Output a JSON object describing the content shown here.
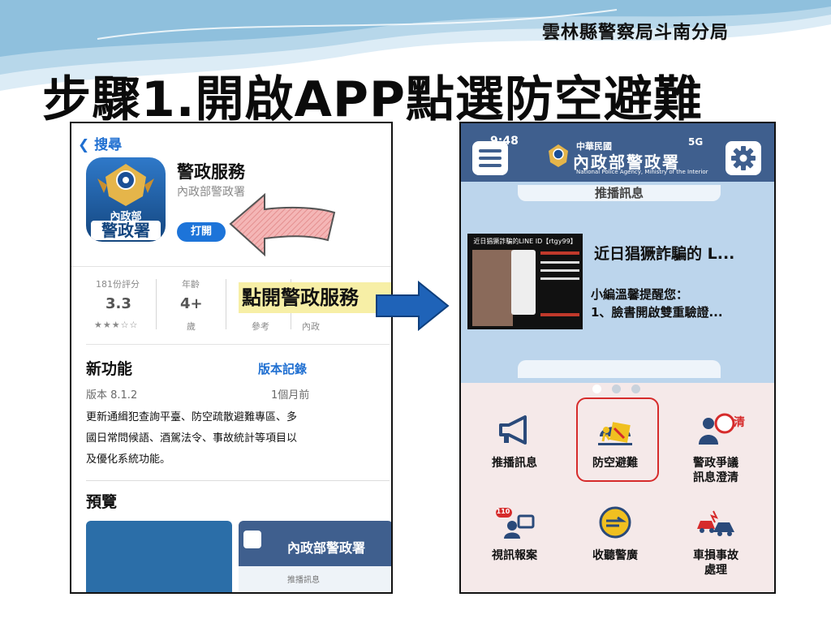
{
  "slide": {
    "org": "雲林縣警察局斗南分局",
    "title": "步驟1.開啟APP點選防空避難"
  },
  "appstore": {
    "back": "搜尋",
    "icon_text_top": "內政部",
    "icon_text_bottom": "警政署",
    "app_name": "警政服務",
    "developer": "內政部警政署",
    "open_label": "打開",
    "highlight": "點開警政服務",
    "stats": [
      {
        "label": "181份評分",
        "value": "3.3",
        "sub": "★★★☆☆"
      },
      {
        "label": "年齡",
        "value": "4+",
        "sub": "歲"
      },
      {
        "label": "",
        "value": "",
        "sub": "參考"
      },
      {
        "label": "",
        "value": "",
        "sub": "內政"
      }
    ],
    "new_features": "新功能",
    "version_history": "版本記錄",
    "version": "版本 8.1.2",
    "ago": "1個月前",
    "description": "更新通緝犯查詢平臺、防空疏散避難專區、多國日常問候語、酒駕法令、事故統計等項目以及優化系統功能。",
    "preview": "預覽",
    "preview_app_label": "推播訊息"
  },
  "app": {
    "status_time": "9:48",
    "status_signal": "5G",
    "logo_small": "中華民國",
    "logo_main": "內政部警政署",
    "logo_en": "National Police Agency, Ministry of the Interior",
    "news_tab": "推播訊息",
    "news_image_caption": "近日猖獗詐騙的LINE ID【rtgy99】",
    "news_title": "近日猖獗詐騙的 L...",
    "news_line1": "小編溫馨提醒您：",
    "news_line2": "1、臉書開啟雙重驗證...",
    "grid": [
      {
        "label": "推播訊息",
        "label2": ""
      },
      {
        "label": "防空避難",
        "label2": ""
      },
      {
        "label": "警政爭議",
        "label2": "訊息澄清"
      },
      {
        "label": "視訊報案",
        "label2": ""
      },
      {
        "label": "收聽警廣",
        "label2": ""
      },
      {
        "label": "車損事故",
        "label2": "處理"
      }
    ],
    "clear_badge": "清",
    "badge_110": "110"
  },
  "colors": {
    "accent_blue": "#1d74d9",
    "app_header": "#3f5f8e",
    "highlight_red": "#d62b2b",
    "arrow_blue": "#1f63b8"
  }
}
